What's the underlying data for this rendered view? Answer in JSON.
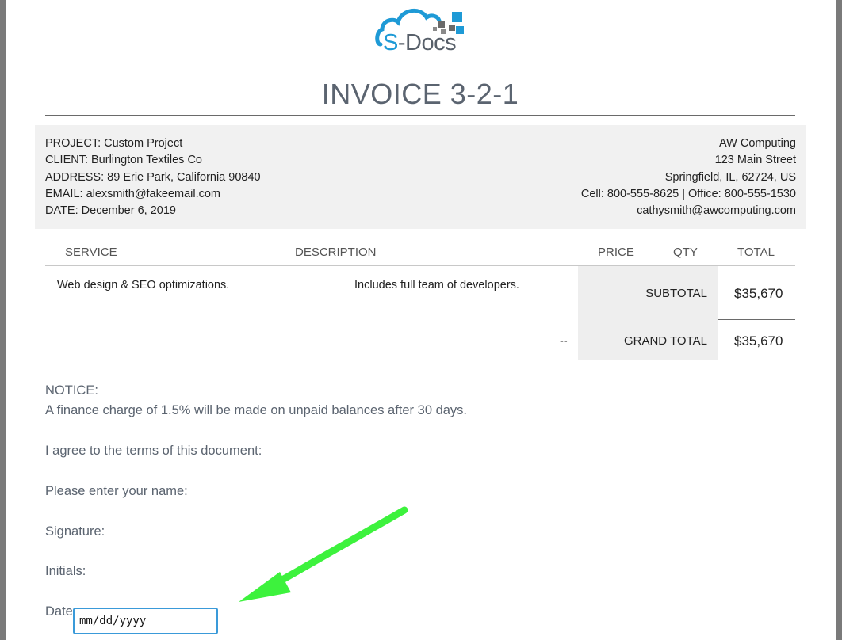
{
  "logo": {
    "prefix": "S",
    "suffix": "-Docs",
    "colors": {
      "blue": "#1e9ad6",
      "gray": "#58606a"
    }
  },
  "title": "INVOICE 3-2-1",
  "project": {
    "project": "PROJECT: Custom Project",
    "client": "CLIENT: Burlington Textiles Co",
    "address": "ADDRESS: 89 Erie Park, California 90840",
    "email": "EMAIL: alexsmith@fakeemail.com",
    "date": "DATE: December 6, 2019"
  },
  "company": {
    "name": "AW Computing",
    "street": "123 Main Street",
    "city": "Springfield, IL, 62724, US",
    "phones": "Cell: 800-555-8625 | Office: 800-555-1530",
    "email": "cathysmith@awcomputing.com"
  },
  "table": {
    "headers": [
      "SERVICE",
      "DESCRIPTION",
      "PRICE",
      "QTY",
      "TOTAL"
    ],
    "row": {
      "service": "Web design & SEO optimizations.",
      "description": "Includes full team of developers.",
      "price": "--"
    },
    "subtotal_label": "SUBTOTAL",
    "subtotal_value": "$35,670",
    "grand_total_label": "GRAND TOTAL",
    "grand_total_value": "$35,670"
  },
  "notice": {
    "heading": "NOTICE:",
    "text": "A finance charge of 1.5% will be made on unpaid balances after 30 days.",
    "agree": "I agree to the terms of this document:",
    "name_prompt": "Please enter your name:",
    "signature": "Signature:",
    "initials": "Initials:",
    "date": "Date"
  },
  "date_input": {
    "placeholder": "mm/dd/yyyy"
  },
  "annotation": {
    "arrow_color": "#3df23d"
  }
}
